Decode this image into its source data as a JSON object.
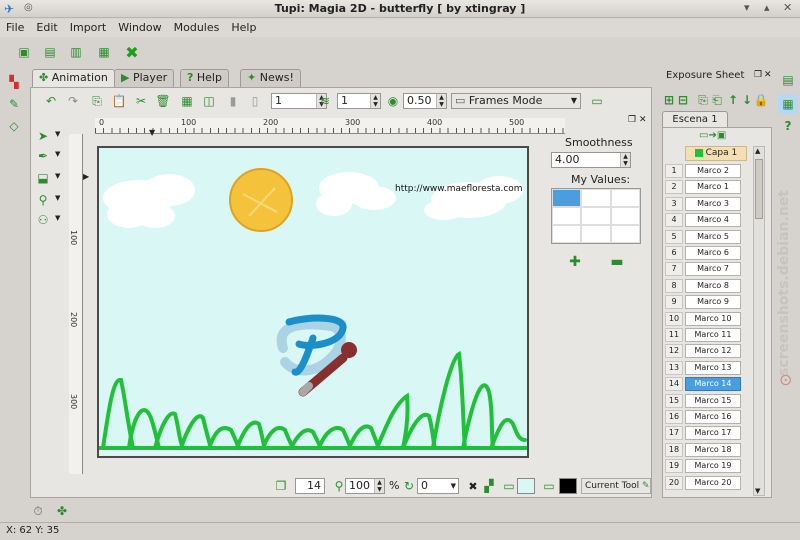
{
  "window": {
    "title": "Tupi: Magia 2D - butterfly [ by xtingray ]"
  },
  "menu": [
    "File",
    "Edit",
    "Import",
    "Window",
    "Modules",
    "Help"
  ],
  "tabs": [
    {
      "label": "Animation"
    },
    {
      "label": "Player"
    },
    {
      "label": "Help"
    },
    {
      "label": "News!"
    }
  ],
  "toolbar": {
    "onion_value": "1",
    "layer_value": "1",
    "opacity_value": "0.50",
    "view_mode": "Frames Mode"
  },
  "ruler": {
    "h_ticks": [
      "0",
      "100",
      "200",
      "300",
      "400",
      "500"
    ],
    "v_ticks": [
      "100",
      "200",
      "300"
    ]
  },
  "canvas": {
    "url_text": "http://www.maefloresta.com",
    "bg_color": "#d9f7f4",
    "sun_color": "#f5c23b",
    "grass_color": "#22c03a",
    "butterfly_color": "#1a8fc9"
  },
  "smoothness": {
    "label": "Smoothness",
    "value": "4.00",
    "values_label": "My Values:"
  },
  "status_bar": {
    "frame_number": "14",
    "zoom": "100",
    "zoom_unit": "%",
    "rotation": "0",
    "current_tool": "Current Tool"
  },
  "coords": "X: 62 Y: 35",
  "exposure": {
    "title": "Exposure Sheet",
    "scene_tab": "Escena 1",
    "layer_name": "Capa 1",
    "rows": [
      {
        "num": "1",
        "label": "Marco 2"
      },
      {
        "num": "2",
        "label": "Marco 1"
      },
      {
        "num": "3",
        "label": "Marco 3"
      },
      {
        "num": "4",
        "label": "Marco 4"
      },
      {
        "num": "5",
        "label": "Marco 5"
      },
      {
        "num": "6",
        "label": "Marco 6"
      },
      {
        "num": "7",
        "label": "Marco 7"
      },
      {
        "num": "8",
        "label": "Marco 8"
      },
      {
        "num": "9",
        "label": "Marco 9"
      },
      {
        "num": "10",
        "label": "Marco 10"
      },
      {
        "num": "11",
        "label": "Marco 11"
      },
      {
        "num": "12",
        "label": "Marco 12"
      },
      {
        "num": "13",
        "label": "Marco 13"
      },
      {
        "num": "14",
        "label": "Marco 14"
      },
      {
        "num": "15",
        "label": "Marco 15"
      },
      {
        "num": "16",
        "label": "Marco 16"
      },
      {
        "num": "17",
        "label": "Marco 17"
      },
      {
        "num": "18",
        "label": "Marco 18"
      },
      {
        "num": "19",
        "label": "Marco 19"
      },
      {
        "num": "20",
        "label": "Marco 20"
      }
    ],
    "selected_row": "14"
  },
  "watermark": "screenshots.debian.net"
}
